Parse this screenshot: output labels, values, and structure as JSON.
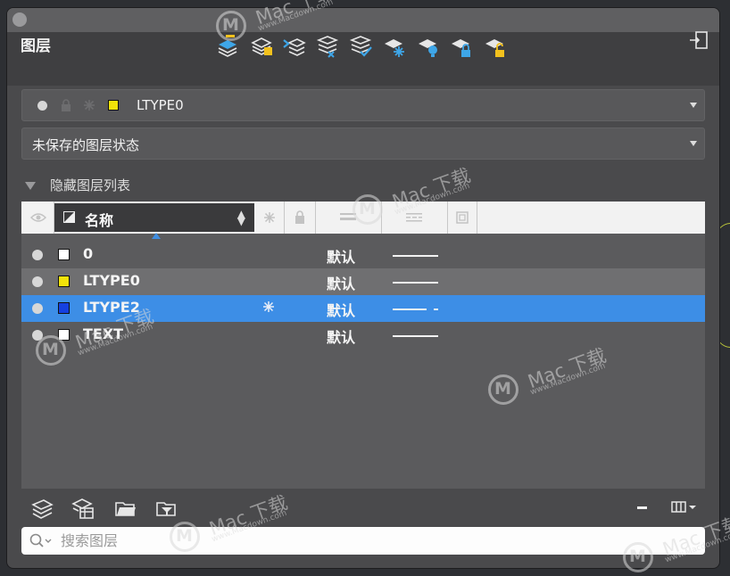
{
  "panel": {
    "title": "图层"
  },
  "current_layer": {
    "name": "LTYPE0",
    "color": "#f2e30a"
  },
  "layer_state": {
    "label": "未保存的图层状态"
  },
  "filter_toggle": {
    "label": "隐藏图层列表"
  },
  "columns": {
    "name": "名称"
  },
  "layers": [
    {
      "name": "0",
      "color": "#ffffff",
      "frozen": false,
      "linetype": "默认",
      "line_style": "solid",
      "state": "normal"
    },
    {
      "name": "LTYPE0",
      "color": "#f2e30a",
      "frozen": false,
      "linetype": "默认",
      "line_style": "solid",
      "state": "alternate"
    },
    {
      "name": "LTYPE2",
      "color": "#1540e0",
      "frozen": true,
      "linetype": "默认",
      "line_style": "dashed",
      "state": "selected"
    },
    {
      "name": "TEXT",
      "color": "#ffffff",
      "frozen": false,
      "linetype": "默认",
      "line_style": "solid",
      "state": "normal"
    }
  ],
  "toolbar_icons": [
    "new-layer-icon",
    "new-layer-vp-frozen-icon",
    "layer-merge-icon",
    "layer-delete-icon",
    "set-current-icon",
    "freeze-all-icon",
    "thaw-all-icon",
    "lock-all-icon",
    "unlock-all-icon"
  ],
  "search": {
    "placeholder": "搜索图层"
  },
  "watermark": {
    "brand": "Mac 下载",
    "url": "www.Macdown.com"
  },
  "colors": {
    "accent": "#3d8ee6",
    "panel_bg": "#4a4a4c"
  }
}
